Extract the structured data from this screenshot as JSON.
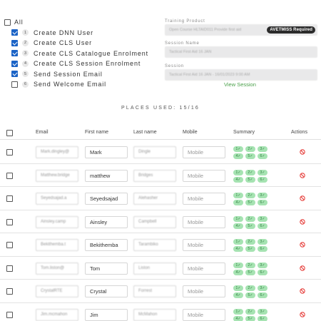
{
  "steps": {
    "all_label": "All",
    "items": [
      {
        "num": "1",
        "label": "Create DNN User",
        "checked": true
      },
      {
        "num": "2",
        "label": "Create CLS User",
        "checked": true
      },
      {
        "num": "3",
        "label": "Create CLS Catalogue Enrolment",
        "checked": true
      },
      {
        "num": "4",
        "label": "Create CLS Session Enrolment",
        "checked": true
      },
      {
        "num": "5",
        "label": "Send Session Email",
        "checked": true
      },
      {
        "num": "6",
        "label": "Send Welcome Email",
        "checked": false
      }
    ]
  },
  "info": {
    "training_product_label": "Training Product",
    "training_product_value": "Open Course HLTAID011 Provide first aid",
    "badge": "AVETMISS Required",
    "session_name_label": "Session Name",
    "session_name_value": "Tactical First Aid 16 JAN",
    "session_label": "Session",
    "session_value": "Tactical First Aid 16 JAN - 16/01/2023 9:00 AM",
    "view_session": "View Session"
  },
  "places": "PLACES USED: 15/16",
  "table": {
    "headers": {
      "email": "Email",
      "first": "First name",
      "last": "Last name",
      "mobile": "Mobile",
      "summary": "Summary",
      "actions": "Actions"
    },
    "mobile_placeholder": "Mobile",
    "summary_pills": [
      "1✓",
      "2✓",
      "3✓",
      "4✓",
      "5✓",
      "6✓"
    ],
    "rows": [
      {
        "email": "Mark.dingley@",
        "first": "Mark",
        "last": "Dingle"
      },
      {
        "email": "Matthew.bridge",
        "first": "matthew",
        "last": "Bridges"
      },
      {
        "email": "Seyedsajad.a",
        "first": "Seyedsajad",
        "last": "Alehasher"
      },
      {
        "email": "Ainsley.camp",
        "first": "Ainsley",
        "last": "Campbell"
      },
      {
        "email": "Bekithemba.t",
        "first": "Bekithemba",
        "last": "Tarambiko"
      },
      {
        "email": "Tom.liston@",
        "first": "Tom",
        "last": "Liston"
      },
      {
        "email": "CrystalRTE",
        "first": "Crystal",
        "last": "Forrest"
      },
      {
        "email": "Jim.mcmahon",
        "first": "Jim",
        "last": "McMahon"
      }
    ]
  },
  "colors": {
    "accent": "#1b63c6",
    "pill_bg": "#a6e3b2",
    "pill_text": "#2e7d3c",
    "delete": "#e53935",
    "link": "#4aa04a"
  },
  "icons": {
    "delete": "ban-icon"
  }
}
